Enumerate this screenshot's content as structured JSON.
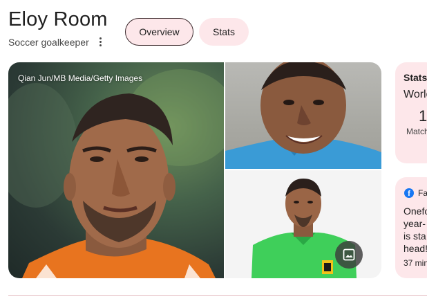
{
  "header": {
    "title": "Eloy Room",
    "subtitle": "Soccer goalkeeper"
  },
  "tabs": [
    {
      "label": "Overview",
      "selected": true
    },
    {
      "label": "Stats",
      "selected": false
    }
  ],
  "gallery": {
    "credit": "Qian Jun/MB Media/Getty Images"
  },
  "stats_card": {
    "title": "Stats",
    "competition": "World",
    "value": "1",
    "value_label": "Match"
  },
  "post_card": {
    "source": "Fa",
    "lines": [
      "Onefo",
      "year-",
      "is sta",
      "head!"
    ],
    "time": "37 min"
  },
  "colors": {
    "chip_bg": "#fde7ea",
    "card_bg": "#fde7ea",
    "facebook_blue": "#1877f2"
  }
}
